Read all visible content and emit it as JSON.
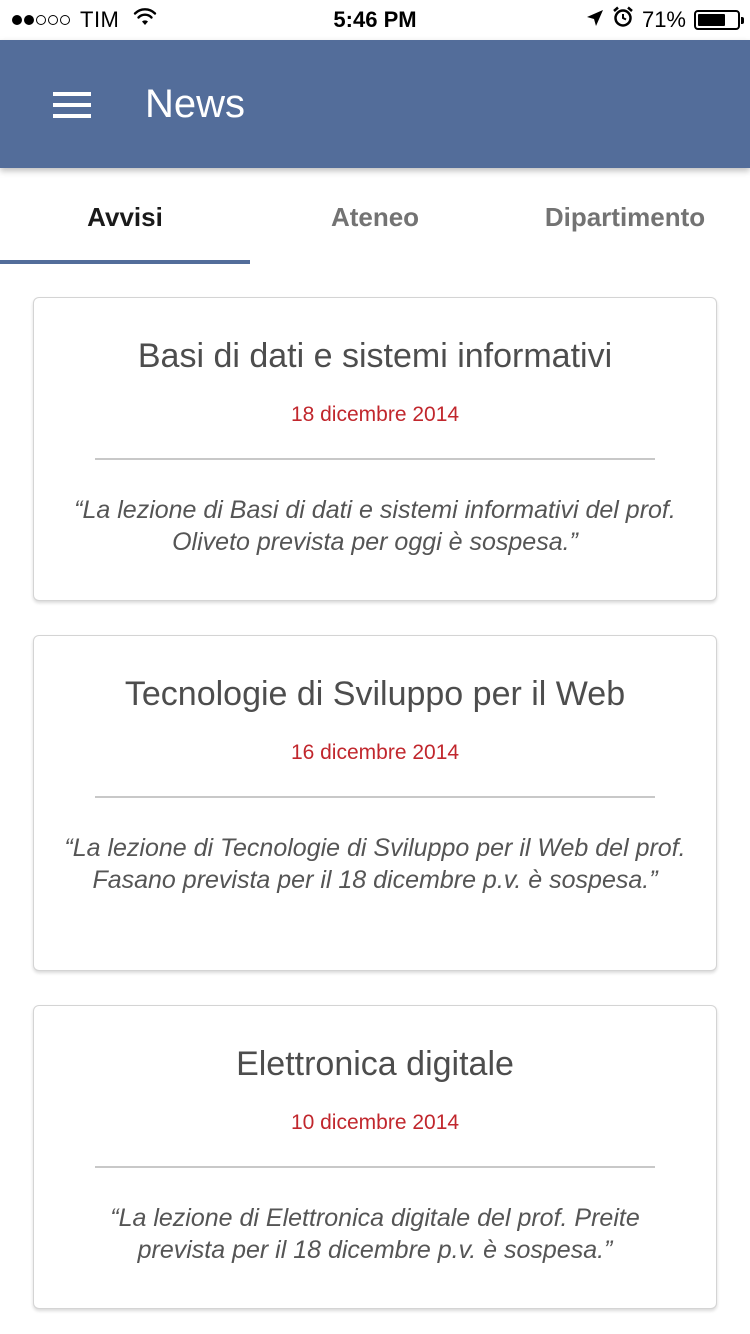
{
  "status_bar": {
    "carrier": "TIM",
    "time": "5:46 PM",
    "battery_percent": "71%",
    "battery_level": 0.71,
    "signal_bars_filled": 2,
    "signal_bars_total": 5,
    "icons": [
      "wifi-icon",
      "location-arrow-icon",
      "alarm-icon",
      "battery-icon"
    ]
  },
  "app_bar": {
    "title": "News",
    "background_color": "#536d9a",
    "menu_icon": "hamburger-menu-icon"
  },
  "tabs": [
    {
      "label": "Avvisi",
      "active": true
    },
    {
      "label": "Ateneo",
      "active": false
    },
    {
      "label": "Dipartimento",
      "active": false
    }
  ],
  "news": [
    {
      "title": "Basi di dati e sistemi informativi",
      "date": "18 dicembre 2014",
      "body": "“La lezione di Basi di dati e sistemi informativi del prof. Oliveto prevista per oggi è sospesa.”"
    },
    {
      "title": "Tecnologie di Sviluppo per il Web",
      "date": "16 dicembre 2014",
      "body": "“La lezione di Tecnologie di Sviluppo per il Web del prof. Fasano prevista per il 18 dicembre p.v. è sospesa.”"
    },
    {
      "title": "Elettronica digitale",
      "date": "10 dicembre 2014",
      "body": "“La lezione di Elettronica digitale del prof. Preite prevista per il 18 dicembre p.v. è sospesa.”"
    }
  ],
  "colors": {
    "accent": "#536d9a",
    "date_red": "#c1272d"
  }
}
